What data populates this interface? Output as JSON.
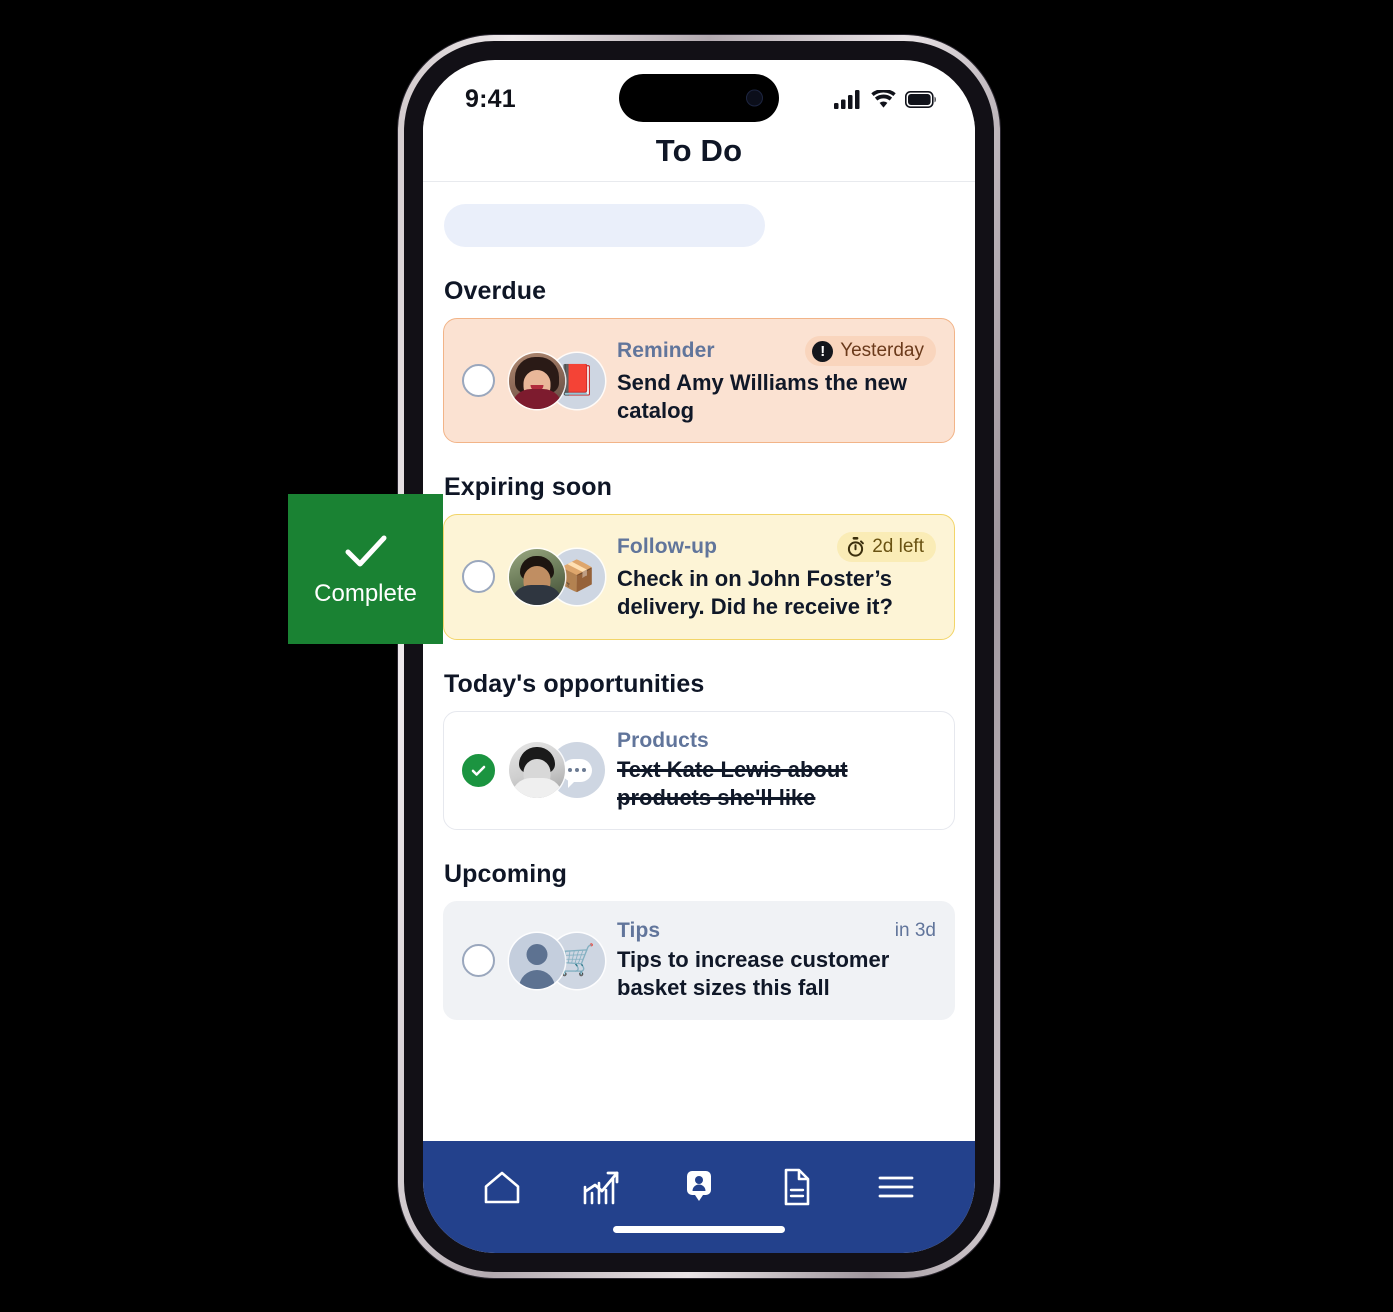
{
  "status_bar": {
    "time": "9:41",
    "cellular_icon": "signal-bars-icon",
    "wifi_icon": "wifi-icon",
    "battery_icon": "battery-icon"
  },
  "header": {
    "title": "To Do"
  },
  "search": {
    "placeholder": ""
  },
  "swipe_action": {
    "label": "Complete",
    "icon": "check-icon",
    "color": "#1a8233"
  },
  "sections": [
    {
      "title": "Overdue",
      "style": "overdue",
      "items": [
        {
          "checked": false,
          "kicker": "Reminder",
          "task": "Send Amy Williams the new catalog",
          "badge": {
            "text": "Yesterday",
            "icon": "alert-circle-icon",
            "style": "alert"
          },
          "avatar_alt": "Amy Williams photo",
          "badge_icon_char": "!",
          "type_icon": "closed-book-icon",
          "type_emoji": "📕"
        }
      ]
    },
    {
      "title": "Expiring soon",
      "style": "expiring",
      "items": [
        {
          "checked": false,
          "kicker": "Follow-up",
          "task": "Check in on John Foster’s delivery. Did he receive it?",
          "badge": {
            "text": "2d left",
            "icon": "stopwatch-icon",
            "style": "timer"
          },
          "avatar_alt": "John Foster photo",
          "type_icon": "package-icon",
          "type_emoji": "📦"
        }
      ]
    },
    {
      "title": "Today's opportunities",
      "style": "plain",
      "items": [
        {
          "checked": true,
          "kicker": "Products",
          "task": "Text Kate Lewis about products she'll like",
          "meta": "",
          "avatar_alt": "Kate Lewis photo",
          "type_icon": "chat-bubble-icon"
        }
      ]
    },
    {
      "title": "Upcoming",
      "style": "upcoming",
      "items": [
        {
          "checked": false,
          "kicker": "Tips",
          "task": "Tips to increase customer basket sizes this fall",
          "meta": "in 3d",
          "avatar_alt": "generic person avatar",
          "type_icon": "shopping-cart-icon",
          "type_emoji": "🛒"
        }
      ]
    }
  ],
  "tabbar": {
    "background": "#23418c",
    "items": [
      {
        "name": "home",
        "icon": "home-icon",
        "active": false
      },
      {
        "name": "insights",
        "icon": "chart-trend-up-icon",
        "active": false
      },
      {
        "name": "contacts",
        "icon": "contact-card-icon",
        "active": true
      },
      {
        "name": "documents",
        "icon": "document-icon",
        "active": false
      },
      {
        "name": "menu",
        "icon": "hamburger-menu-icon",
        "active": false
      }
    ]
  },
  "colors": {
    "overdue_bg": "#fbe2d2",
    "overdue_border": "#f2b488",
    "expiring_bg": "#fdf4d6",
    "expiring_border": "#f2d569",
    "upcoming_bg": "#f0f2f5",
    "kicker": "#61759b",
    "complete_green": "#1a8233",
    "nav_blue": "#23418c",
    "skeleton": "#eaeffa"
  }
}
